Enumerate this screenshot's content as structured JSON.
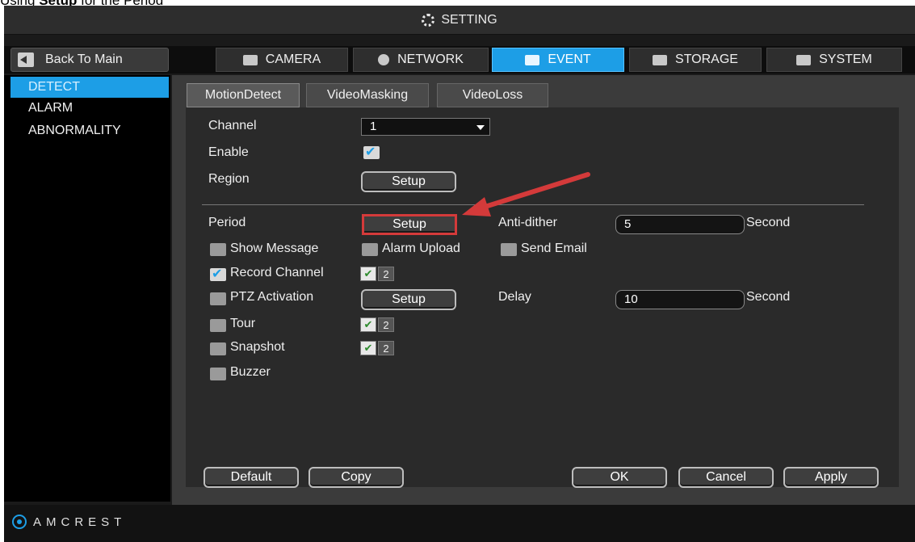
{
  "caption": {
    "prefix": "Using ",
    "emphasis": "Setup",
    "suffix": " for the Period"
  },
  "titlebar": {
    "title": "SETTING",
    "icon": "gear-icon"
  },
  "navbar": {
    "back_label": "Back To Main",
    "tabs": [
      {
        "label": "CAMERA",
        "icon": "camera-icon"
      },
      {
        "label": "NETWORK",
        "icon": "globe-icon"
      },
      {
        "label": "EVENT",
        "icon": "event-icon",
        "active": true
      },
      {
        "label": "STORAGE",
        "icon": "monitor-icon"
      },
      {
        "label": "SYSTEM",
        "icon": "system-icon"
      }
    ]
  },
  "sidebar": {
    "items": [
      {
        "label": "DETECT",
        "active": true
      },
      {
        "label": "ALARM"
      },
      {
        "label": "ABNORMALITY"
      }
    ]
  },
  "subtabs": [
    {
      "label": "MotionDetect",
      "active": true
    },
    {
      "label": "VideoMasking"
    },
    {
      "label": "VideoLoss"
    }
  ],
  "form": {
    "channel_label": "Channel",
    "channel_value": "1",
    "enable_label": "Enable",
    "enable_checked": true,
    "region_label": "Region",
    "region_button": "Setup",
    "period_label": "Period",
    "period_button": "Setup",
    "antidither_label": "Anti-dither",
    "antidither_value": "5",
    "antidither_unit": "Second",
    "show_message": "Show Message",
    "alarm_upload": "Alarm Upload",
    "send_email": "Send Email",
    "record_channel": "Record Channel",
    "ptz_activation": "PTZ Activation",
    "ptz_button": "Setup",
    "delay_label": "Delay",
    "delay_value": "10",
    "delay_unit": "Second",
    "tour": "Tour",
    "snapshot": "Snapshot",
    "buzzer": "Buzzer",
    "channel_chips": [
      "1",
      "2"
    ]
  },
  "buttons": {
    "default": "Default",
    "copy": "Copy",
    "ok": "OK",
    "cancel": "Cancel",
    "apply": "Apply"
  },
  "footer": {
    "logo": "AMCREST"
  },
  "colors": {
    "accent": "#1d9ee6",
    "annotation": "#d43a3a"
  }
}
